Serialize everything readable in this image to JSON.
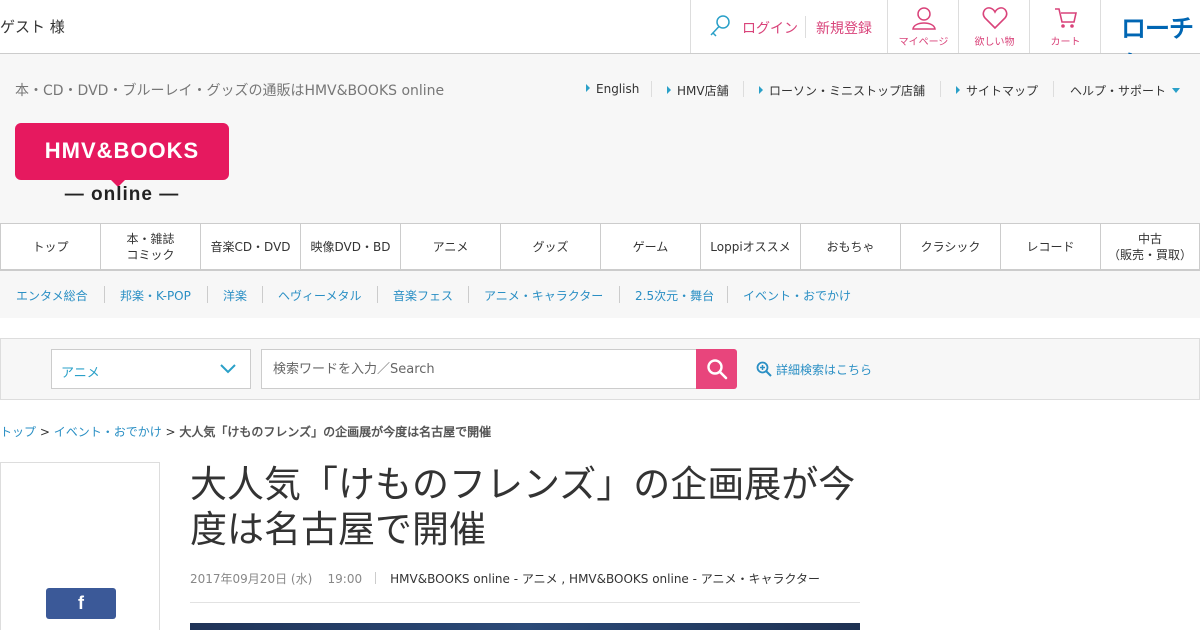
{
  "topbar": {
    "guest": "ゲスト 様",
    "login": "ログイン",
    "register": "新規登録",
    "mypage": "マイページ",
    "wishlist": "欲しい物",
    "cart": "カート",
    "lawson_logo": "ローチケ"
  },
  "header": {
    "tagline": "本・CD・DVD・ブルーレイ・グッズの通販はHMV&BOOKS online",
    "util_links": [
      "English",
      "HMV店舗",
      "ローソン・ミニストップ店舗",
      "サイトマップ",
      "ヘルプ・サポート"
    ],
    "logo_main": "HMV&BOOKS",
    "logo_sub": "— online —"
  },
  "mainnav": [
    "トップ",
    "本・雑誌\nコミック",
    "音楽CD・DVD",
    "映像DVD・BD",
    "アニメ",
    "グッズ",
    "ゲーム",
    "Loppiオススメ",
    "おもちゃ",
    "クラシック",
    "レコード",
    "中古\n（販売・買取）"
  ],
  "subnav": [
    "エンタメ総合",
    "邦楽・K-POP",
    "洋楽",
    "ヘヴィーメタル",
    "音楽フェス",
    "アニメ・キャラクター",
    "2.5次元・舞台",
    "イベント・おでかけ"
  ],
  "search": {
    "category": "アニメ",
    "placeholder": "検索ワードを入力／Search",
    "advanced": "詳細検索はこちら"
  },
  "breadcrumb": {
    "top": "トップ",
    "sep": " > ",
    "category": "イベント・おでかけ",
    "current": "大人気「けものフレンズ」の企画展が今度は名古屋で開催"
  },
  "article": {
    "title": "大人気「けものフレンズ」の企画展が今度は名古屋で開催",
    "date": "2017年09月20日 (水)",
    "time": "19:00",
    "sources": "HMV&BOOKS online - アニメ , HMV&BOOKS online - アニメ・キャラクター"
  },
  "share": {
    "facebook": "f"
  },
  "colors": {
    "accent_pink": "#e6195f",
    "link_blue": "#2a8fc4",
    "facebook": "#3b5998"
  }
}
